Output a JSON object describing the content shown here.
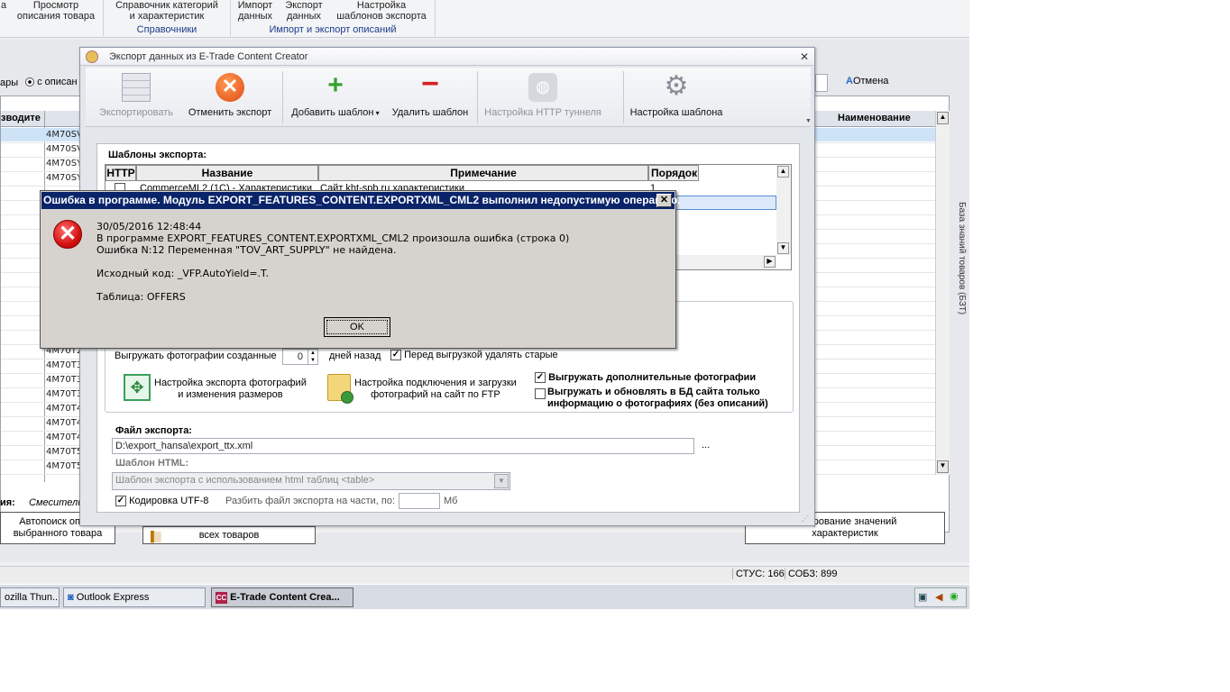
{
  "ribbon": {
    "buttons": [
      "а",
      "Просмотр\nописания товара",
      "Справочник категорий\nи характеристик",
      "Импорт\nданных",
      "Экспорт\nданных",
      "Настройка\nшаблонов экспорта"
    ],
    "groups": [
      "Справочники",
      "Импорт и экспорт описаний"
    ]
  },
  "main": {
    "filter_label": "ары",
    "radio_label": "с описан",
    "cancel_label": "Отмена",
    "col_producer": "зводите",
    "col_name": "Наименование",
    "rows": [
      "4M70SV",
      "4M70SV",
      "4M70SY",
      "4M70SY",
      "",
      "",
      "",
      "",
      "",
      "",
      "",
      "",
      "",
      "",
      "4M70T2",
      "4M70T2",
      "4M70T3",
      "4M70T3",
      "4M70T3",
      "4M70T4",
      "4M70T4",
      "4M70T4",
      "4M70T5",
      "4M70T5"
    ],
    "bottom_label": "ия:",
    "bottom_value": "Смесители",
    "btn_autosearch": "Автопоиск описа\nвыбранного товара",
    "btn_all": "всех товаров",
    "btn_edit_values": "актирование значений\nхарактеристик",
    "side_tab": "База знаний товаров (БЗТ)"
  },
  "export_window": {
    "title": "Экспорт данных из E-Trade Content Creator",
    "toolbar": {
      "export": "Экспортировать",
      "cancel_export": "Отменить экспорт",
      "add_template": "Добавить шаблон",
      "delete_template": "Удалить шаблон",
      "http_tunnel": "Настройка HTTP туннеля",
      "template_settings": "Настройка шаблона"
    },
    "templates_label": "Шаблоны экспорта:",
    "columns": [
      "HTTP",
      "Название",
      "Примечание",
      "Порядок"
    ],
    "first_row": {
      "name": "CommerceML2 (1С) - Характеристики",
      "note": "Сайт kht-spb.ru характеристики",
      "order": "1"
    },
    "photos_days_label": "Выгружать фотографии созданные",
    "photos_days_value": "0",
    "days_ago": "дней назад",
    "delete_old": "Перед выгрузкой удалять старые",
    "photo_export_settings": "Настройка экспорта фотографий\nи изменения размеров",
    "photo_ftp_settings": "Настройка подключения и загрузки\nфотографий на сайт по FTP",
    "extra_photos": "Выгружать дополнительные фотографии",
    "photo_info_only": "Выгружать и обновлять в БД сайта только\nинформацию о фотографиях (без описаний)",
    "export_file_label": "Файл экспорта:",
    "export_file_value": "D:\\export_hansa\\export_ttx.xml",
    "browse": "...",
    "html_template_label": "Шаблон HTML:",
    "html_template_value": "Шаблон экспорта с использованием html таблиц <table>",
    "utf8": "Кодировка UTF-8",
    "split_label": "Разбить файл экспорта на части, по:",
    "split_unit": "Мб"
  },
  "error_dialog": {
    "title": "Ошибка в программе. Модуль EXPORT_FEATURES_CONTENT.EXPORTXML_CML2 выполнил недопустимую операцию.",
    "close": "✕",
    "datetime": "30/05/2016 12:48:44",
    "line1": "В программе EXPORT_FEATURES_CONTENT.EXPORTXML_CML2 произошла ошибка (строка 0)",
    "line2": "Ошибка N:12 Переменная \"TOV_ART_SUPPLY\" не найдена.",
    "source": "Исходный код: _VFP.AutoYield=.T.",
    "table": "Таблица: OFFERS",
    "ok": "OK"
  },
  "status_bar": {
    "stus": "СТУС: 166",
    "sobz": "СОБЗ: 899"
  },
  "taskbar": {
    "items": [
      "ozilla Thun...",
      "Outlook Express",
      "E-Trade Content Crea..."
    ]
  }
}
